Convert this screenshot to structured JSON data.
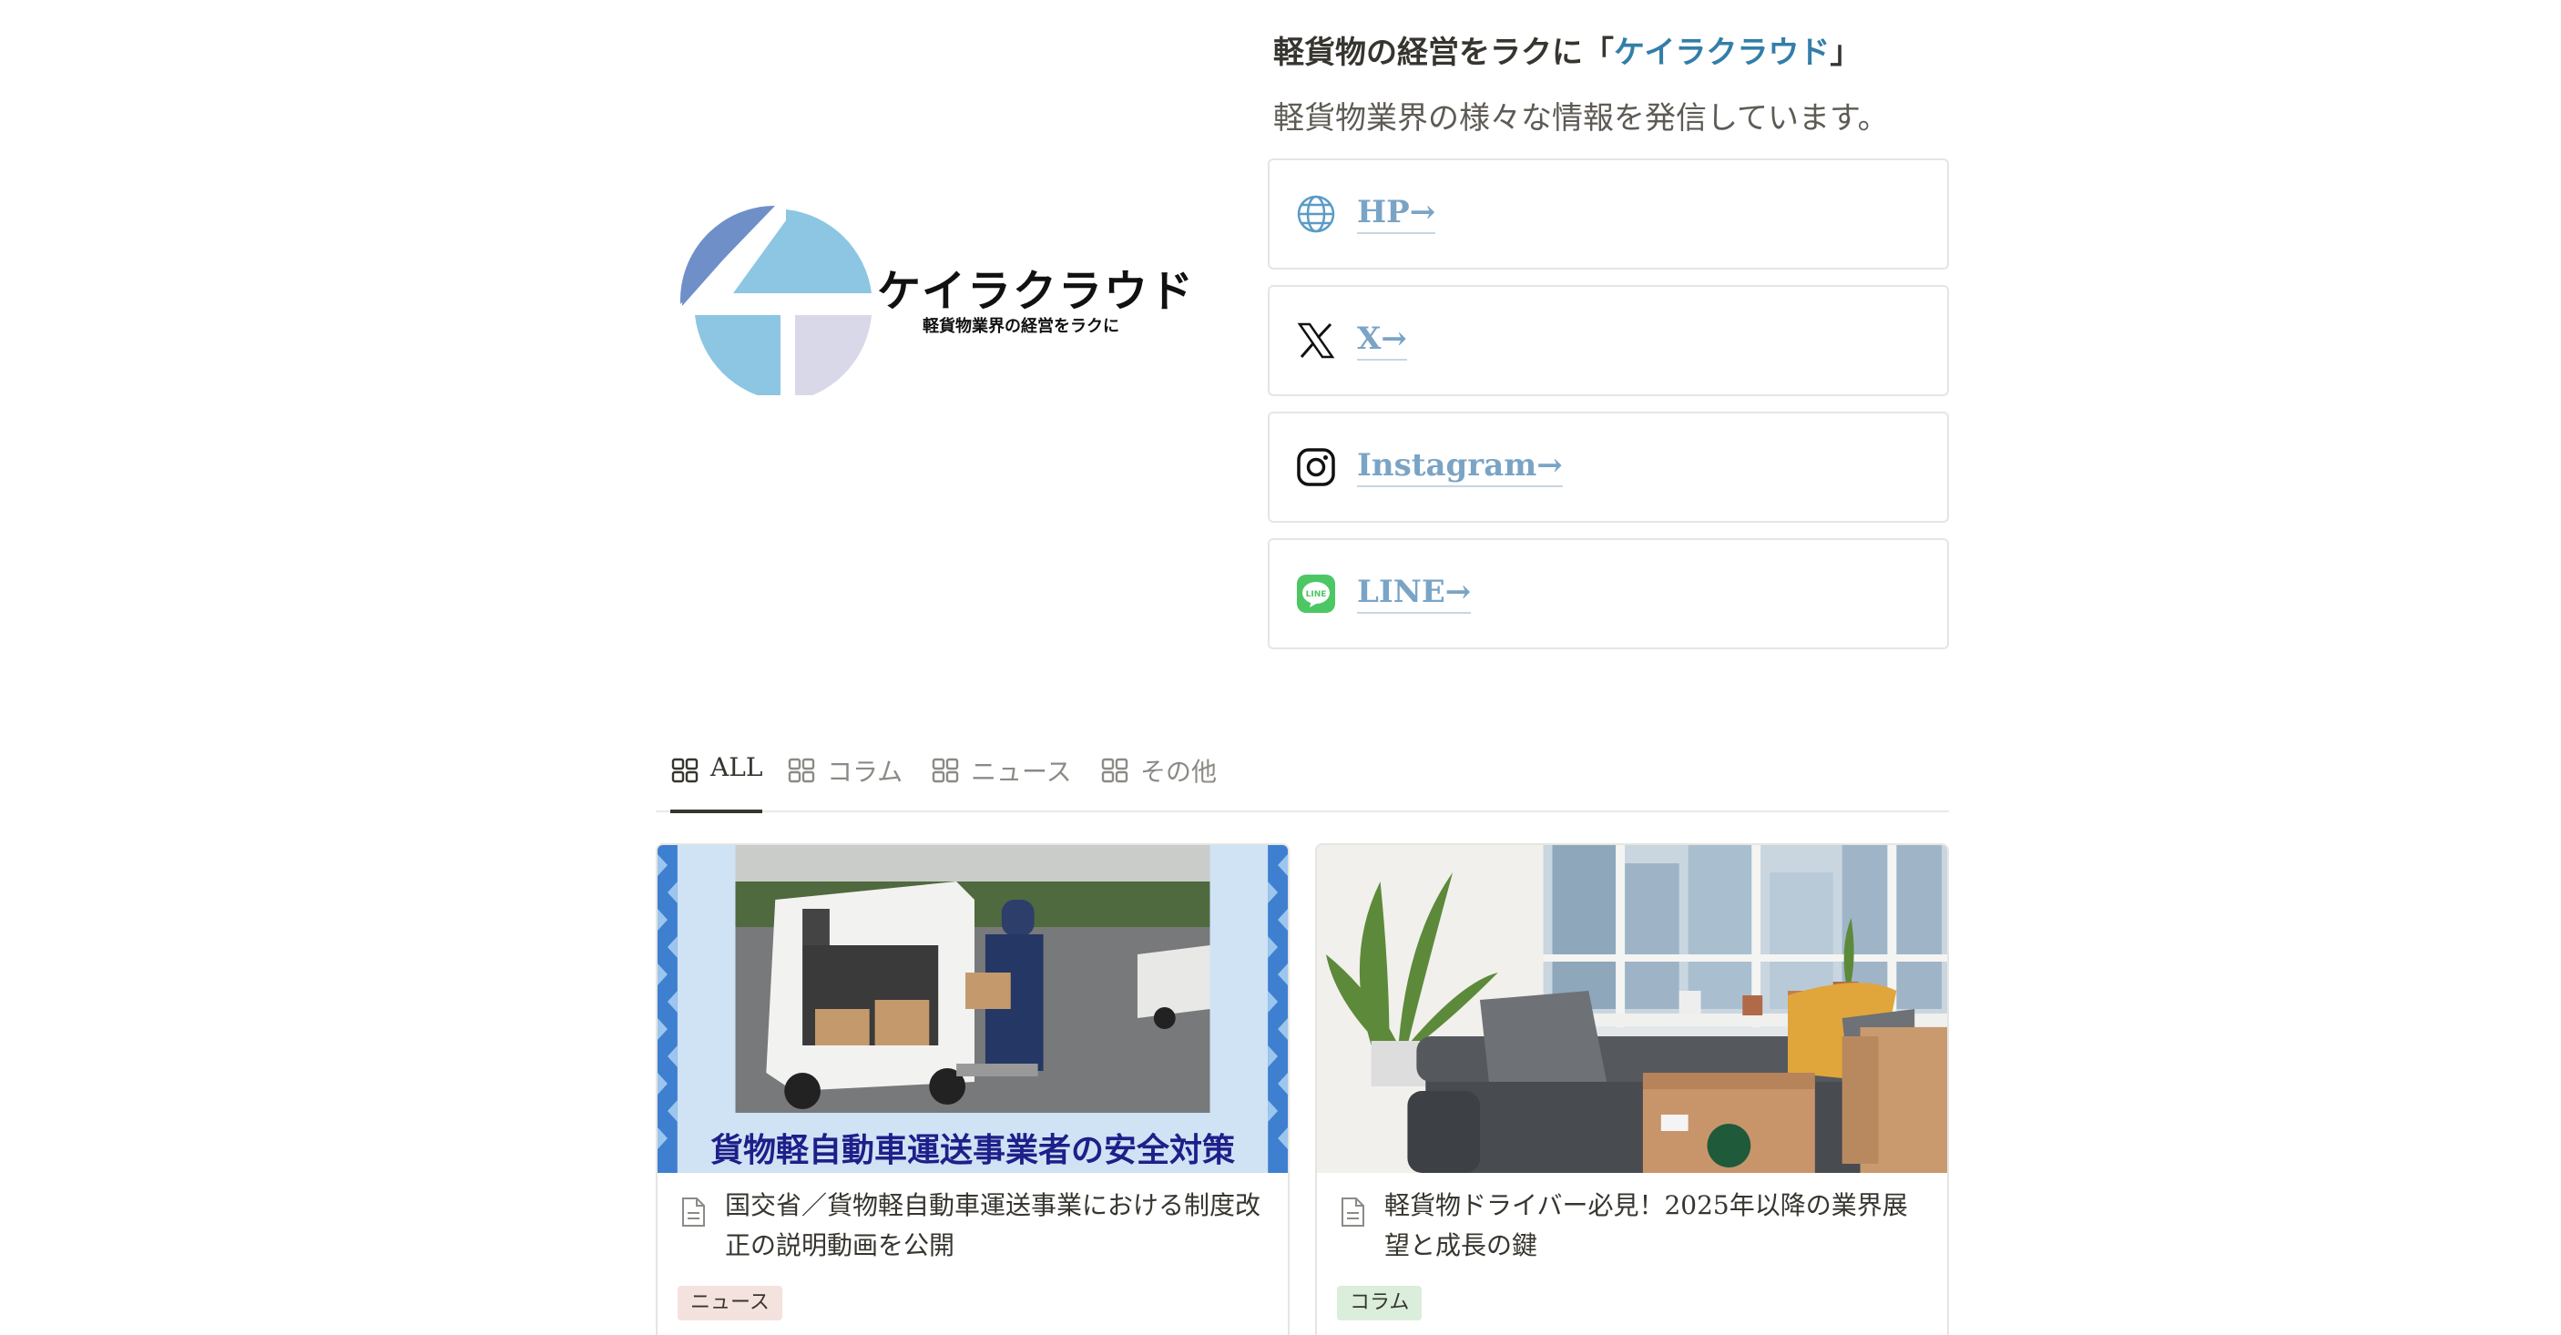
{
  "logo": {
    "name": "ケイラクラウド",
    "tagline": "軽貨物業界の経営をラクに"
  },
  "intro": {
    "title_prefix": "軽貨物の経営をラクに「",
    "title_accent": "ケイラクラウド",
    "title_suffix": "」",
    "description": "軽貨物業界の様々な情報を発信しています。"
  },
  "links": [
    {
      "label": "HP→",
      "icon": "globe-icon"
    },
    {
      "label": "X→",
      "icon": "x-logo-icon"
    },
    {
      "label": "Instagram→",
      "icon": "instagram-icon"
    },
    {
      "label": "LINE→",
      "icon": "line-icon"
    }
  ],
  "tabs": [
    {
      "label": "ALL",
      "active": true
    },
    {
      "label": "コラム",
      "active": false
    },
    {
      "label": "ニュース",
      "active": false
    },
    {
      "label": "その他",
      "active": false
    }
  ],
  "cards": [
    {
      "thumb_caption": "貨物軽自動車運送事業者の安全対策",
      "title": "国交省／貨物軽自動車運送事業における制度改正の説明動画を公開",
      "tag": "ニュース",
      "tag_color": "#f4e2de"
    },
    {
      "title": "軽貨物ドライバー必見！2025年以降の業界展望と成長の鍵",
      "tag": "コラム",
      "tag_color": "#dbeddb"
    }
  ],
  "colors": {
    "accent": "#337ea9",
    "link": "#7aa4c6",
    "line_green": "#4cc764"
  }
}
